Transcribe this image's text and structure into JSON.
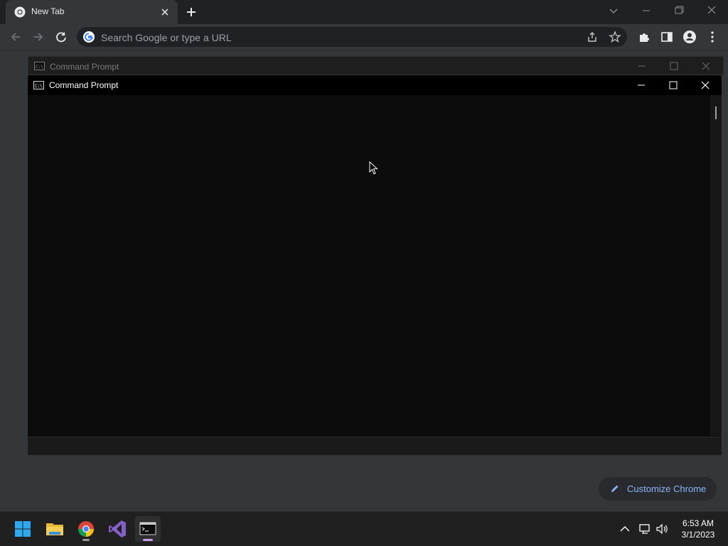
{
  "browser": {
    "tab": {
      "title": "New Tab"
    },
    "omnibox": {
      "placeholder": "Search Google or type a URL"
    },
    "customize_label": "Customize Chrome"
  },
  "cmd_back": {
    "title": "Command Prompt"
  },
  "cmd_main": {
    "title": "Command Prompt"
  },
  "taskbar": {
    "apps": [
      "windows-start",
      "file-explorer",
      "google-chrome",
      "visual-studio",
      "command-prompt"
    ],
    "clock": {
      "time": "6:53 AM",
      "date": "3/1/2023"
    }
  },
  "colors": {
    "chrome_frame": "#202124",
    "chrome_toolbar": "#35363a",
    "cmd_background": "#0c0c0c",
    "accent_link": "#8ab4f8"
  }
}
